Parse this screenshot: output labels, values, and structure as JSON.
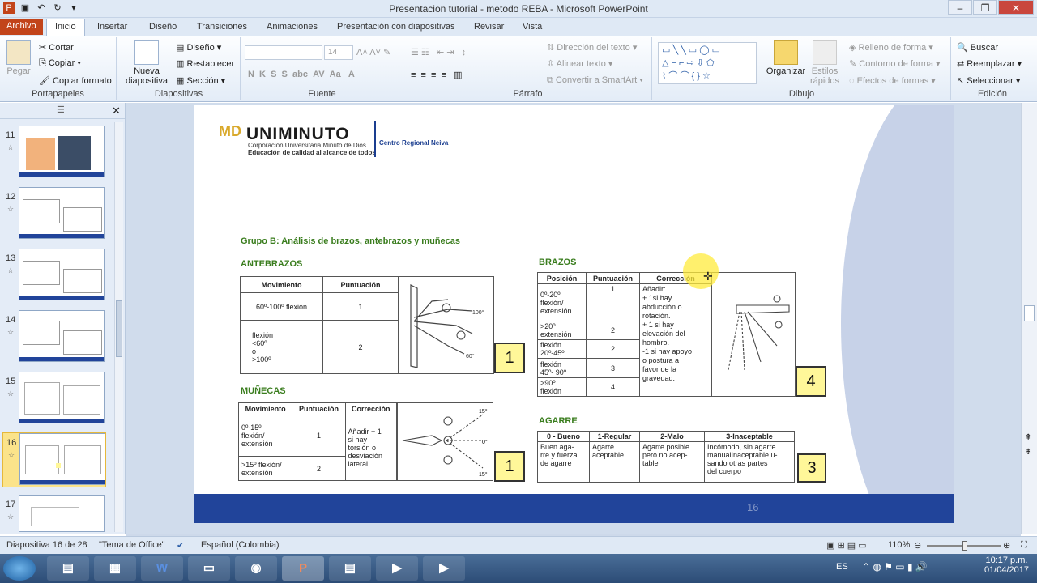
{
  "window": {
    "title": "Presentacion tutorial - metodo REBA  -  Microsoft PowerPoint"
  },
  "tabs": [
    "Archivo",
    "Inicio",
    "Insertar",
    "Diseño",
    "Transiciones",
    "Animaciones",
    "Presentación con diapositivas",
    "Revisar",
    "Vista"
  ],
  "ribbon": {
    "portapapeles": {
      "label": "Portapapeles",
      "pegar": "Pegar",
      "cortar": "Cortar",
      "copiar": "Copiar",
      "copiar_formato": "Copiar formato"
    },
    "diapositivas": {
      "label": "Diapositivas",
      "nueva": "Nueva",
      "diapositiva": "diapositiva",
      "diseno": "Diseño",
      "restablecer": "Restablecer",
      "seccion": "Sección"
    },
    "fuente": {
      "label": "Fuente",
      "size": "14"
    },
    "parrafo": {
      "label": "Párrafo",
      "direccion": "Dirección del texto",
      "alinear": "Alinear texto",
      "smartart": "Convertir a SmartArt"
    },
    "dibujo": {
      "label": "Dibujo",
      "organizar": "Organizar",
      "estilos": "Estilos",
      "rapidos": "rápidos",
      "relleno": "Relleno de forma",
      "contorno": "Contorno de forma",
      "efectos": "Efectos de formas"
    },
    "edicion": {
      "label": "Edición",
      "buscar": "Buscar",
      "reemplazar": "Reemplazar",
      "seleccionar": "Seleccionar"
    }
  },
  "thumbnails": [
    {
      "num": "11",
      "star": "☆"
    },
    {
      "num": "12",
      "star": "☆"
    },
    {
      "num": "13",
      "star": "☆"
    },
    {
      "num": "14",
      "star": "☆"
    },
    {
      "num": "15",
      "star": "☆"
    },
    {
      "num": "16",
      "star": "☆"
    },
    {
      "num": "17",
      "star": "☆"
    }
  ],
  "slide": {
    "logo": {
      "name": "UNIMINUTO",
      "line1": "Corporación Universitaria Minuto de Dios",
      "line2": "Educación de calidad al alcance de todos",
      "region": "Centro Regional Neiva",
      "mark": "MD"
    },
    "group_title": "Grupo B: Análisis de brazos, antebrazos y muñecas",
    "antebrazos": {
      "title": "ANTEBRAZOS",
      "headers": [
        "Movimiento",
        "Puntuación"
      ],
      "rows": [
        [
          "60º-100º flexión",
          "1"
        ],
        [
          "flexión\n<60º\no\n>100º",
          "2"
        ]
      ],
      "score": "1"
    },
    "munecas": {
      "title": "MUÑECAS",
      "headers": [
        "Movimiento",
        "Puntuación",
        "Corrección"
      ],
      "rows": [
        [
          "0º-15º\nflexión/\nextensión",
          "1",
          "Añadir + 1\nsi hay\ntorsión o\ndesviación\nlateral"
        ],
        [
          ">15º flexión/\nextensión",
          "2",
          ""
        ]
      ],
      "score": "1"
    },
    "brazos": {
      "title": "BRAZOS",
      "headers": [
        "Posición",
        "Puntuación",
        "Corrección"
      ],
      "rows": [
        [
          "0º-20º\nflexión/\nextensión",
          "1"
        ],
        [
          ">20º\nextensión",
          "2"
        ],
        [
          "flexión\n20º-45º",
          "2"
        ],
        [
          "flexión\n45º- 90º",
          "3"
        ],
        [
          ">90º\nflexión",
          "4"
        ]
      ],
      "correccion": "Añadir:\n+ 1si hay\nabducción o\nrotación.\n+ 1 si hay\nelevación del\nhombro.\n-1 si hay apoyo\no postura a\nfavor de la\ngravedad.",
      "score": "4"
    },
    "agarre": {
      "title": "AGARRE",
      "headers": [
        "0 - Bueno",
        "1-Regular",
        "2-Malo",
        "3-Inaceptable"
      ],
      "row": [
        "Buen aga-\nrre y fuerza\nde agarre",
        "Agarre\naceptable",
        "Agarre posible\npero no acep-\ntable",
        "Incómodo, sin agarre\nmanualInaceptable u-\nsando otras partes\ndel cuerpo"
      ],
      "score": "3"
    },
    "page_number": "16"
  },
  "status": {
    "slide": "Diapositiva 16 de 28",
    "theme": "\"Tema de Office\"",
    "lang": "Español (Colombia)",
    "zoom": "110%"
  },
  "taskbar": {
    "lang": "ES",
    "time": "10:17 p.m.",
    "date": "01/04/2017"
  }
}
